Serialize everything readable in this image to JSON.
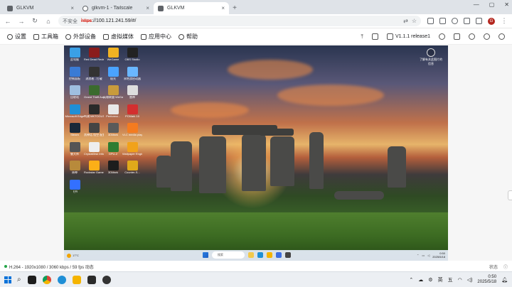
{
  "browser": {
    "tabs": [
      {
        "title": "GLKVM",
        "close": "×",
        "active": false
      },
      {
        "title": "glkvm-1 - Tailscale",
        "close": "×",
        "active": false
      },
      {
        "title": "GLKVM",
        "close": "×",
        "active": true
      }
    ],
    "new_tab": "+",
    "window_controls": {
      "minimize": "—",
      "maximize": "▢",
      "close": "✕"
    },
    "nav": {
      "back": "←",
      "forward": "→",
      "reload": "↻",
      "home": "⌂"
    },
    "address": {
      "security_label": "不安全",
      "scheme": "https",
      "rest": "://100.121.241.59/#/"
    },
    "profile_initial": "G"
  },
  "kvm_toolbar": {
    "items": [
      {
        "label": "设置",
        "icon": "gear-icon"
      },
      {
        "label": "工具箱",
        "icon": "toolbox-icon"
      },
      {
        "label": "外部设备",
        "icon": "device-icon"
      },
      {
        "label": "虚拟媒体",
        "icon": "media-icon"
      },
      {
        "label": "应用中心",
        "icon": "apps-icon"
      },
      {
        "label": "帮助",
        "icon": "help-icon"
      }
    ],
    "version": "V1.1.1 release1"
  },
  "remote_desktop": {
    "icons": [
      {
        "label": "此电脑",
        "color": "#3aa0e6"
      },
      {
        "label": "Red Dead Redempti...",
        "color": "#8a1c1c"
      },
      {
        "label": "WeGame",
        "color": "#f0b323"
      },
      {
        "label": "OBS Studio",
        "color": "#222"
      },
      {
        "label": "控制面板",
        "color": "#3a7bd5"
      },
      {
        "label": "流浪者 - 打破",
        "color": "#333"
      },
      {
        "label": "极光",
        "color": "#4aa3ff"
      },
      {
        "label": "米哈游启动器",
        "color": "#6ab7ff"
      },
      {
        "label": "回收站",
        "color": "#9fbfe0"
      },
      {
        "label": "Grand Theft Auto V 增...",
        "color": "#3b6b2e"
      },
      {
        "label": "英雄联盟 WeGame版",
        "color": "#c89b3c"
      },
      {
        "label": "雷神",
        "color": "#ddd"
      },
      {
        "label": "Microsoft Edge",
        "color": "#1f8fd6"
      },
      {
        "label": "鸣潮 MKTOOLS",
        "color": "#2a2a2a"
      },
      {
        "label": "Performa...",
        "color": "#e8e8e8"
      },
      {
        "label": "PCMark 10",
        "color": "#d32f2f"
      },
      {
        "label": "Steam",
        "color": "#1b2838"
      },
      {
        "label": "黑神话 悟空 配置工具",
        "color": "#444"
      },
      {
        "label": "3DMark",
        "color": "#5a5a5a"
      },
      {
        "label": "VLC media player",
        "color": "#f47b20"
      },
      {
        "label": "鲁大师",
        "color": "#555"
      },
      {
        "label": "CrystalDisk Info",
        "color": "#eee"
      },
      {
        "label": "GPU-Z",
        "color": "#2e7d32"
      },
      {
        "label": "Wallpaper Engine",
        "color": "#f1a21a"
      },
      {
        "label": "原神",
        "color": "#b88a3b"
      },
      {
        "label": "Rockstar Games",
        "color": "#fcaf17"
      },
      {
        "label": "3DMark",
        "color": "#1d1d1d"
      },
      {
        "label": "Counter-S...",
        "color": "#e0a91b"
      },
      {
        "label": "飞书",
        "color": "#3370ff"
      }
    ],
    "top_right_label": "了解有关此图片的信息",
    "taskbar": {
      "weather": "17°C",
      "search_placeholder": "搜索",
      "clock_time": "0:50",
      "clock_date": "2025/5/18"
    }
  },
  "status_bar": {
    "stream_info": "H.264 - 1920x1080 / 3060 kbps / 59 fps 动态",
    "right_label": "状态"
  },
  "local_taskbar": {
    "search_icon": "⌕",
    "tray_text": [
      "英",
      "五"
    ],
    "clock_time": "0:50",
    "clock_date": "2025/5/18"
  }
}
